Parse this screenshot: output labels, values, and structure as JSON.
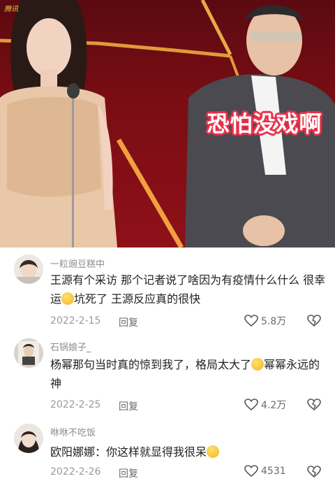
{
  "video": {
    "watermark": "腾讯",
    "caption": "恐怕没戏啊"
  },
  "comments": [
    {
      "username": "一粒豌豆糕中",
      "text_part1": "王源有个采访 那个记者说了啥因为有疫情什么什么 很幸运",
      "text_part2": "坑死了 王源反应真的很快",
      "date": "2022-2-15",
      "reply_label": "回复",
      "likes": "5.8万"
    },
    {
      "username": "石锅娘子_",
      "text_part1": "杨幂那句当时真的惊到我了，格局太大了",
      "text_part2": "幂幂永远的神",
      "date": "2022-2-25",
      "reply_label": "回复",
      "likes": "4.2万"
    },
    {
      "username": "咻咻不吃饭",
      "text_part1": "欧阳娜娜：你这样就显得我很呆",
      "text_part2": "",
      "date": "2022-2-26",
      "reply_label": "回复",
      "likes": "4531"
    }
  ]
}
